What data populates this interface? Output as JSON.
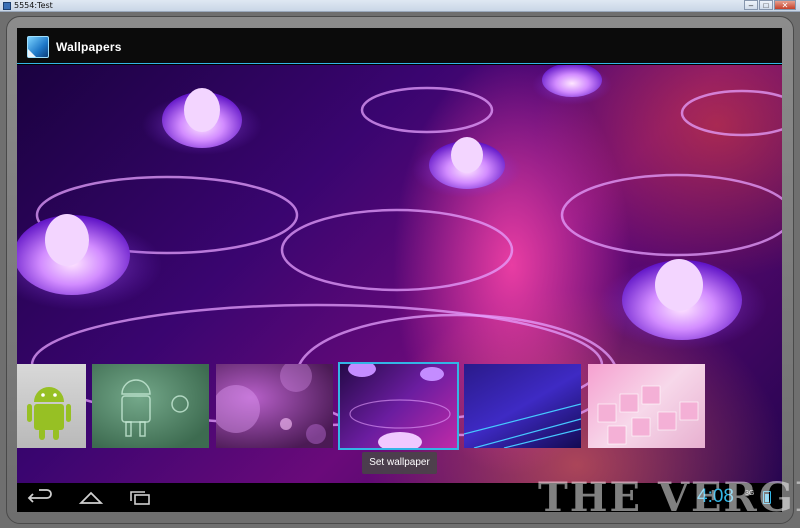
{
  "window": {
    "title": "5554:Test",
    "minimize": "–",
    "maximize": "□",
    "close": "✕"
  },
  "action_bar": {
    "title": "Wallpapers"
  },
  "thumbnails": [
    {
      "name": "android-bot"
    },
    {
      "name": "android-sketch"
    },
    {
      "name": "purple-bokeh"
    },
    {
      "name": "lotus-flowers",
      "selected": true
    },
    {
      "name": "blue-lines"
    },
    {
      "name": "pink-cubes"
    }
  ],
  "set_wallpaper_button": "Set wallpaper",
  "system_bar": {
    "clock": "4:08",
    "network": "3G"
  },
  "watermark": "THE VERGE",
  "colors": {
    "accent": "#33b5e5"
  }
}
